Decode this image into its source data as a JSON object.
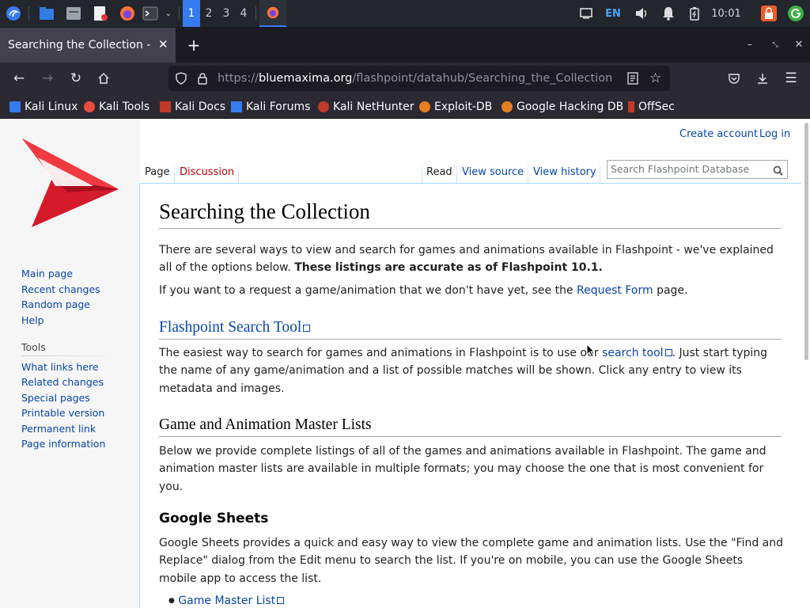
{
  "panel": {
    "workspaces": [
      "1",
      "2",
      "3",
      "4"
    ],
    "active_workspace": "1",
    "language": "EN",
    "clock": "10:01"
  },
  "browser": {
    "tab_title": "Searching the Collection - Flashpoint Database",
    "url_scheme": "https://",
    "url_domain": "bluemaxima.org",
    "url_path": "/flashpoint/datahub/Searching_the_Collection"
  },
  "bookmarks": [
    {
      "label": "Kali Linux",
      "color": "#367bf0"
    },
    {
      "label": "Kali Tools",
      "color": "#e74c3c"
    },
    {
      "label": "Kali Docs",
      "color": "#c0392b"
    },
    {
      "label": "Kali Forums",
      "color": "#367bf0"
    },
    {
      "label": "Kali NetHunter",
      "color": "#c0392b"
    },
    {
      "label": "Exploit-DB",
      "color": "#e67e22"
    },
    {
      "label": "Google Hacking DB",
      "color": "#e67e22"
    },
    {
      "label": "OffSec",
      "color": "#c0392b"
    }
  ],
  "wiki": {
    "personal": {
      "create_account": "Create account",
      "log_in": "Log in"
    },
    "tabs": {
      "page": "Page",
      "discussion": "Discussion",
      "read": "Read",
      "view_source": "View source",
      "view_history": "View history"
    },
    "search_placeholder": "Search Flashpoint Database",
    "nav": [
      "Main page",
      "Recent changes",
      "Random page",
      "Help"
    ],
    "tools_heading": "Tools",
    "tools": [
      "What links here",
      "Related changes",
      "Special pages",
      "Printable version",
      "Permanent link",
      "Page information"
    ],
    "title": "Searching the Collection",
    "intro_text": "There are several ways to view and search for games and animations available in Flashpoint - we've explained all of the options below.",
    "intro_bold": "These listings are accurate as of Flashpoint 10.1.",
    "request_pre": "If you want to a request a game/animation that we don't have yet, see the",
    "request_link": "Request Form",
    "request_post": "page.",
    "section1_title": "Flashpoint Search Tool",
    "section1_pre": "The easiest way to search for games and animations in Flashpoint is to use our",
    "section1_link": "search tool",
    "section1_post": ". Just start typing the name of any game/animation and a list of possible matches will be shown. Click any entry to view its metadata and images.",
    "section2_title": "Game and Animation Master Lists",
    "section2_text": "Below we provide complete listings of all of the games and animations available in Flashpoint. The game and animation master lists are available in multiple formats; you may choose the one that is most convenient for you.",
    "section3_title": "Google Sheets",
    "section3_text": "Google Sheets provides a quick and easy way to view the complete game and animation lists. Use the \"Find and Replace\" dialog from the Edit menu to search the list. If you're on mobile, you can use the Google Sheets mobile app to access the list.",
    "list_item1": "Game Master List"
  }
}
